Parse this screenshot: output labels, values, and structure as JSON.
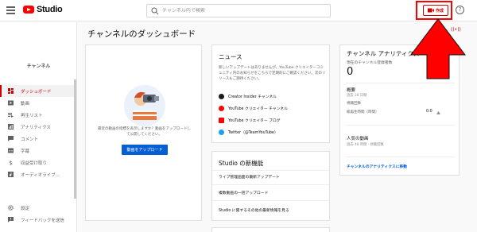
{
  "header": {
    "logo_text": "Studio",
    "search_placeholder": "チャンネル内で検索",
    "create_label": "作成",
    "help_glyph": "?"
  },
  "sidebar": {
    "channel_label": "チャンネル",
    "items": [
      {
        "label": "ダッシュボード",
        "icon": "dashboard-icon",
        "active": true
      },
      {
        "label": "動画",
        "icon": "video-icon"
      },
      {
        "label": "再生リスト",
        "icon": "playlist-icon"
      },
      {
        "label": "アナリティクス",
        "icon": "analytics-icon"
      },
      {
        "label": "コメント",
        "icon": "comment-icon"
      },
      {
        "label": "字幕",
        "icon": "subtitles-icon"
      },
      {
        "label": "収益受け取り",
        "icon": "dollar-icon"
      },
      {
        "label": "オーディオライブ...",
        "icon": "audio-library-icon"
      }
    ],
    "bottom_items": [
      {
        "label": "設定",
        "icon": "gear-icon"
      },
      {
        "label": "フィードバックを送信",
        "icon": "feedback-icon"
      }
    ]
  },
  "main": {
    "title": "チャンネルのダッシュボード",
    "live_label": "((•))"
  },
  "upload_card": {
    "message": "最近の動画の指標を表示しますか？動画をアップロードして公開してください。",
    "button_label": "動画をアップロード"
  },
  "news_card": {
    "heading": "ニュース",
    "body": "新しいアップデートはありませんが、YouTube クリエイターコミュニティ内のお知らせをこちらで定期的にご確認ください。次のリリースもご期待ください。",
    "links": [
      {
        "label": "Creator Insider チャンネル",
        "icon": "creator-insider-icon",
        "color": "#1a1a1a"
      },
      {
        "label": "YouTube クリエイター チャンネル",
        "icon": "youtube-creators-icon",
        "color": "#ff0000"
      },
      {
        "label": "YouTube クリエイター ブログ",
        "icon": "blog-icon",
        "color": "#ff0000"
      },
      {
        "label": "Twitter（@TeamYouTube）",
        "icon": "twitter-icon",
        "color": "#1da1f2"
      }
    ]
  },
  "whatsnew_card": {
    "heading": "Studio の新機能",
    "items": [
      "ライブ管理画面の最新アップデート",
      "複数動画の一括アップロード",
      "Studio に関するその他の最新情報を見る"
    ]
  },
  "analytics_card": {
    "title": "チャンネル アナリティクス",
    "subs_label": "現在のチャンネル登録者数",
    "subs_value": "0",
    "summary_title": "概要",
    "summary_sub": "過去 28 日間",
    "views_label": "視聴回数",
    "watch_time_label": "総再生時間（時間）",
    "watch_time_value": "0.0",
    "popular_title": "人気の動画",
    "popular_sub": "過去 48 時間 · 視聴回数",
    "link_label": "チャンネルのアナリティクスに移動"
  },
  "colors": {
    "accent": "#cc0000",
    "link": "#065fd4",
    "arrow": "#ff0000"
  }
}
